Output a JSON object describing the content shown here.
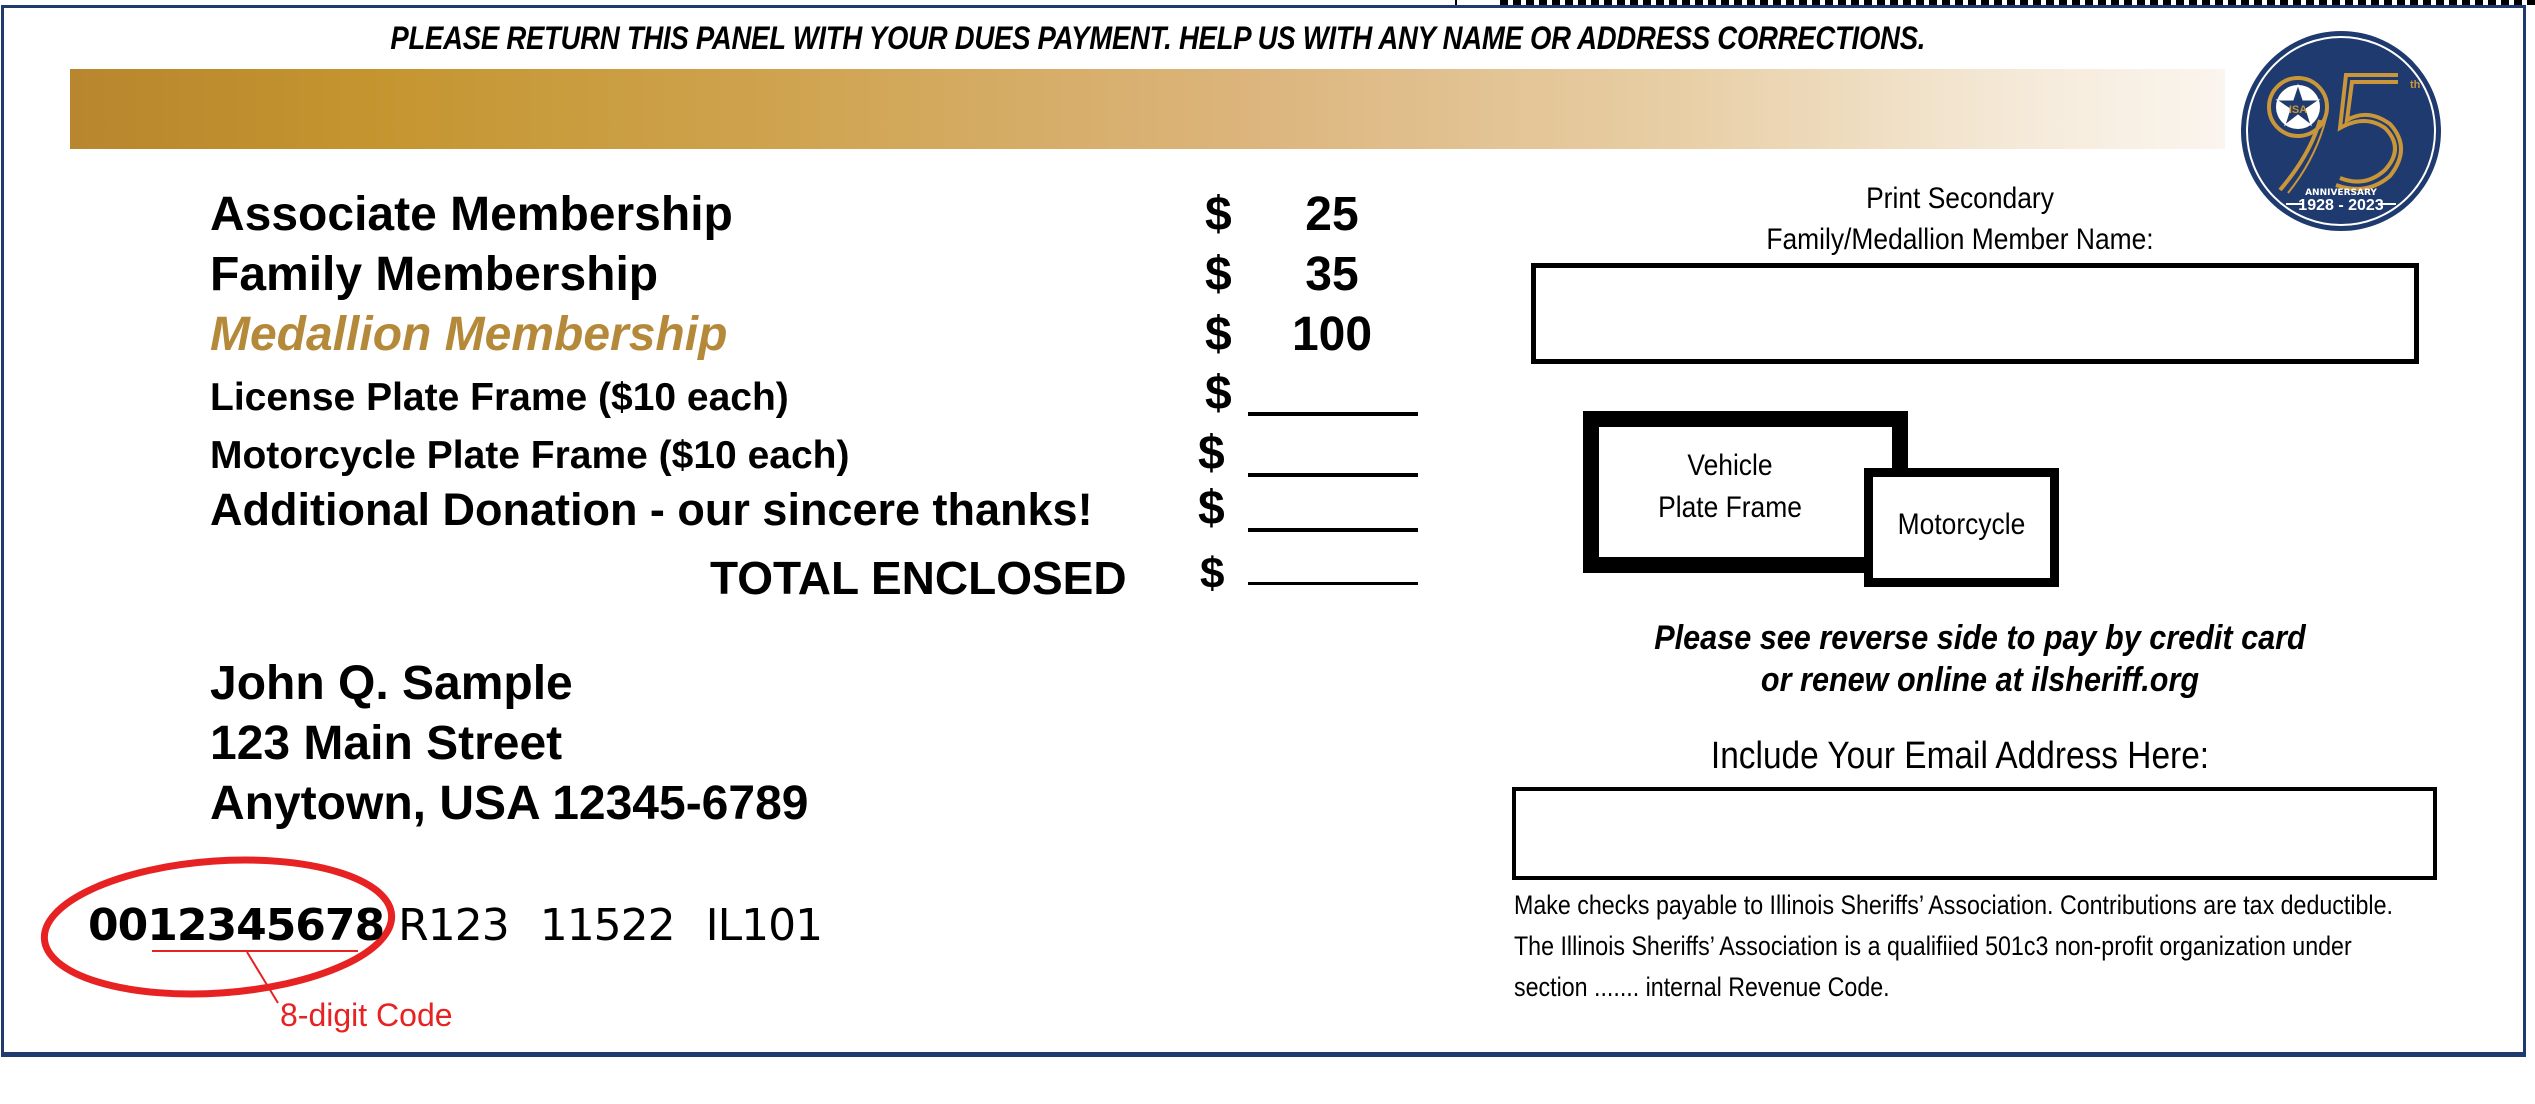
{
  "header": {
    "instruction": "PLEASE RETURN THIS PANEL WITH YOUR DUES PAYMENT.  HELP US WITH ANY NAME OR ADDRESS CORRECTIONS."
  },
  "seal": {
    "number": "95",
    "suffix": "th",
    "caption": "ANNIVERSARY",
    "years": "1928 - 2023",
    "badge_letters": "ISA",
    "colors": {
      "navy": "#1f3a6e",
      "gold": "#c9963a",
      "white": "#ffffff"
    }
  },
  "fees": {
    "currency_symbol": "$",
    "items": [
      {
        "label": "Associate Membership",
        "amount": "25"
      },
      {
        "label": "Family Membership",
        "amount": "35"
      },
      {
        "label": "Medallion Membership",
        "amount": "100"
      },
      {
        "label": "License Plate Frame ($10 each)",
        "amount": ""
      },
      {
        "label": "Motorcycle Plate Frame ($10 each)",
        "amount": ""
      },
      {
        "label": "Additional Donation - our sincere thanks!",
        "amount": ""
      }
    ],
    "total_label": "TOTAL ENCLOSED",
    "total_amount": ""
  },
  "address": {
    "name": "John Q. Sample",
    "street": "123 Main Street",
    "city_line": "Anytown, USA 12345-6789"
  },
  "member_code": {
    "code": "0012345678",
    "rest": "R123 11522 IL101",
    "annotation": "8-digit Code",
    "annotation_color": "#e62222"
  },
  "secondary_member": {
    "label_line1": "Print Secondary",
    "label_line2": "Family/Medallion Member Name:",
    "value": ""
  },
  "plate_frames": {
    "vehicle_line1": "Vehicle",
    "vehicle_line2": "Plate Frame",
    "motorcycle": "Motorcycle"
  },
  "credit_note": {
    "line1": "Please see reverse side to pay by credit card",
    "line2": "or renew online at ilsheriff.org"
  },
  "email": {
    "label": "Include Your Email Address Here:",
    "value": ""
  },
  "legal": {
    "line1": "Make checks payable to Illinois Sheriffs’ Association. Contributions are tax deductible.",
    "line2": "The Illinois Sheriffs’ Association is a qualifiied 501c3 non-profit organization under",
    "line3": "section ....... internal Revenue Code."
  }
}
